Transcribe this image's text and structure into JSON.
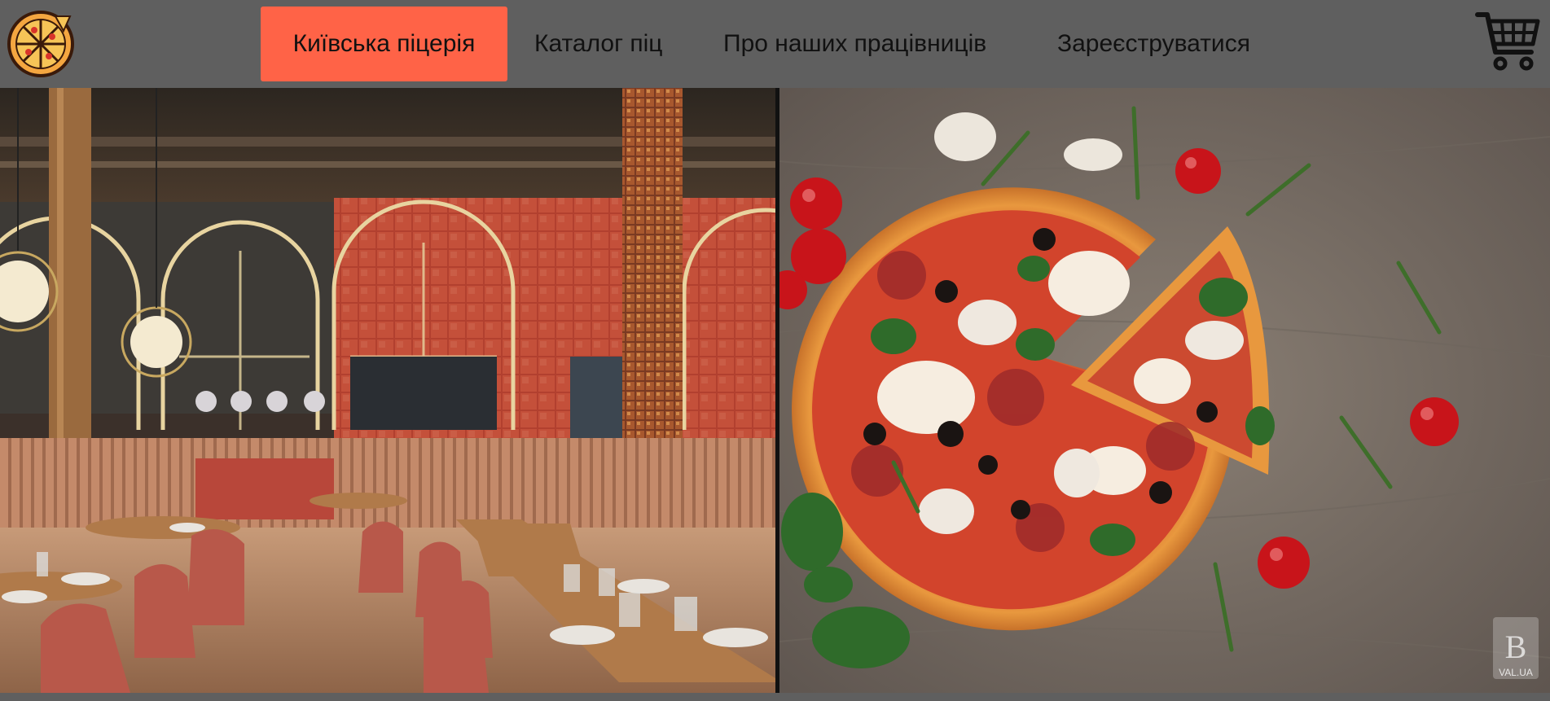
{
  "navbar": {
    "logo_icon": "pizza-icon",
    "items": [
      {
        "label": "Київська піцерія",
        "active": true
      },
      {
        "label": "Каталог піц",
        "active": false
      },
      {
        "label": "Про наших працівниців",
        "active": false
      },
      {
        "label": "Зареєструватися",
        "active": false
      }
    ],
    "cart_icon": "shopping-cart-icon"
  },
  "colors": {
    "navbar_bg": "#5f5f5f",
    "active_bg": "#ff6347",
    "text": "#111111"
  },
  "watermark": {
    "logo": "B",
    "text": "VAL.UA"
  }
}
